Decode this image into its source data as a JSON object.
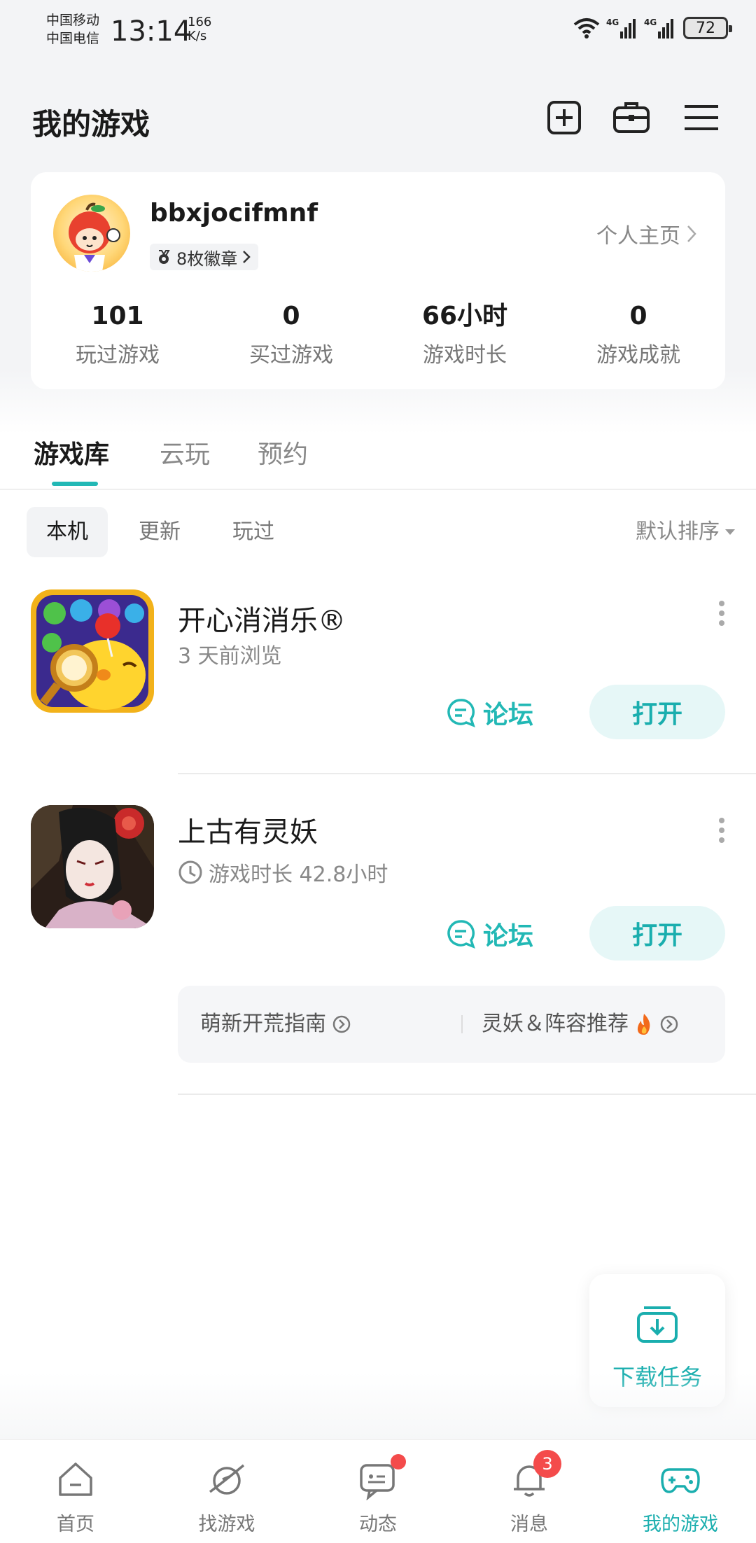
{
  "status_bar": {
    "carrier_1": "中国移动",
    "carrier_2": "中国电信",
    "time": "13:14",
    "speed_value": "166",
    "speed_unit": "K/s",
    "signal_1": "4G",
    "signal_2": "4G",
    "battery": "72"
  },
  "header": {
    "title": "我的游戏",
    "icons": [
      "add-square-icon",
      "toolbox-icon",
      "menu-icon"
    ]
  },
  "profile": {
    "username": "bbxjocifmnf",
    "badges": "8枚徽章",
    "home_link": "个人主页",
    "stats": [
      {
        "value": "101",
        "label": "玩过游戏"
      },
      {
        "value": "0",
        "label": "买过游戏"
      },
      {
        "value": "66小时",
        "label": "游戏时长"
      },
      {
        "value": "0",
        "label": "游戏成就"
      }
    ]
  },
  "tabs": [
    {
      "label": "游戏库",
      "active": true
    },
    {
      "label": "云玩",
      "active": false
    },
    {
      "label": "预约",
      "active": false
    }
  ],
  "filters": [
    {
      "label": "本机",
      "active": true
    },
    {
      "label": "更新",
      "active": false
    },
    {
      "label": "玩过",
      "active": false
    }
  ],
  "sort_label": "默认排序",
  "games": [
    {
      "name": "开心消消乐®",
      "sub": "3 天前浏览",
      "forum": "论坛",
      "open": "打开"
    },
    {
      "name": "上古有灵妖",
      "sub": "游戏时长 42.8小时",
      "forum": "论坛",
      "open": "打开"
    }
  ],
  "guides": [
    {
      "label": "萌新开荒指南"
    },
    {
      "label": "灵妖＆阵容推荐"
    }
  ],
  "download_task": "下载任务",
  "bottom_nav": [
    {
      "label": "首页",
      "icon": "home-icon"
    },
    {
      "label": "找游戏",
      "icon": "planet-icon"
    },
    {
      "label": "动态",
      "icon": "chat-icon"
    },
    {
      "label": "消息",
      "icon": "bell-icon",
      "badge": "3"
    },
    {
      "label": "我的游戏",
      "icon": "gamepad-icon",
      "active": true
    }
  ],
  "colors": {
    "accent": "#22B8B5",
    "badge_red": "#F44B4B"
  }
}
